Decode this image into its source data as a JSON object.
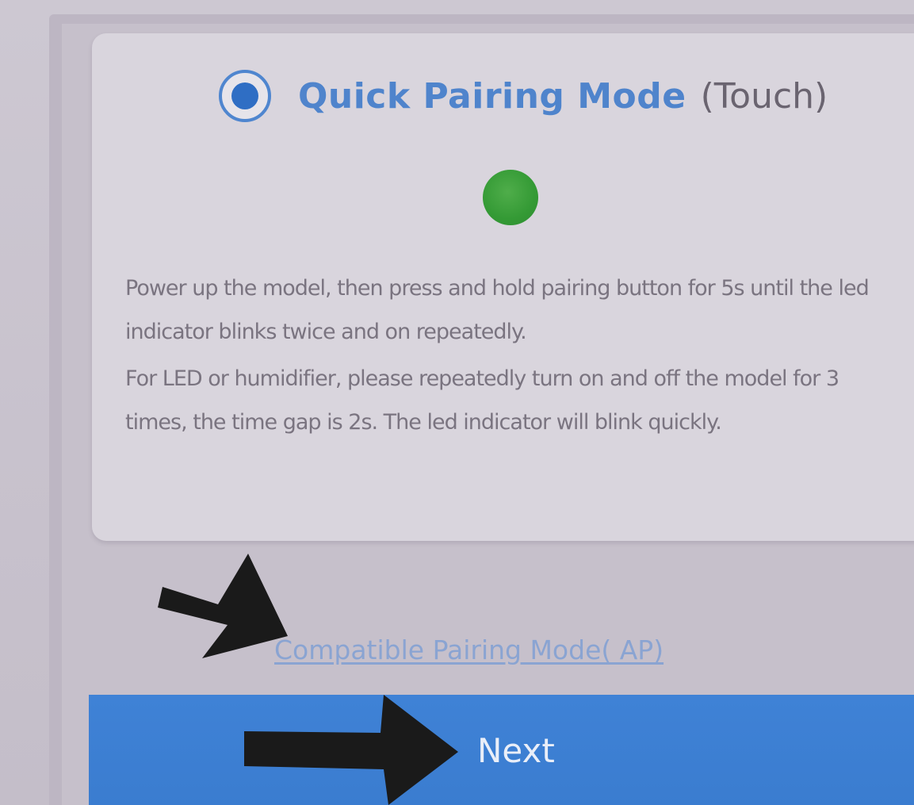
{
  "pairing_card": {
    "mode_title": "Quick Pairing Mode",
    "mode_subtitle": "(Touch)",
    "mode_selected": true,
    "led_color": "#349a35",
    "instruction_1": "Power up the model, then press and hold pairing button for 5s until the led indicator blinks twice and on repeatedly.",
    "instruction_2": "For LED or humidifier, please repeatedly turn on and off the model for 3 times, the time gap is 2s. The led indicator will blink quickly."
  },
  "compatible_link": "Compatible Pairing Mode( AP)",
  "next_button": {
    "label": "Next",
    "color": "#3f82d6"
  },
  "colors": {
    "accent": "#4f84cc",
    "arrow": "#1a1a1a"
  }
}
